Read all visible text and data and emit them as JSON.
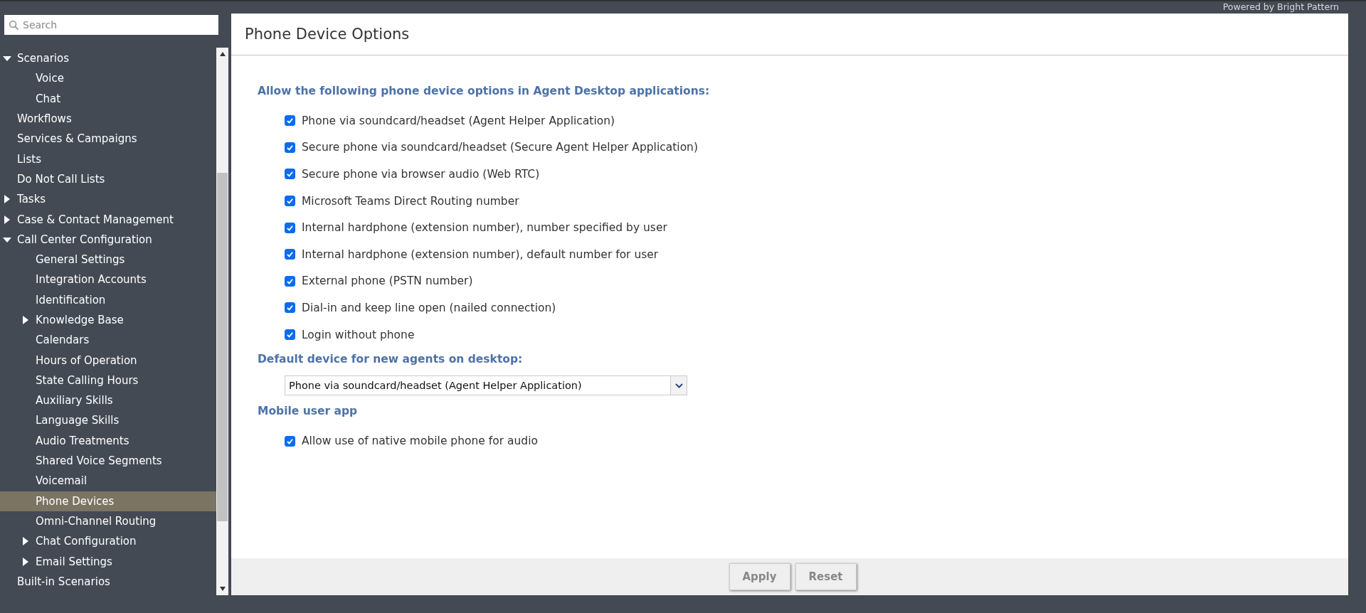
{
  "brand": "Powered by Bright Pattern",
  "sidebar": {
    "search": {
      "placeholder": "Search"
    },
    "items": [
      {
        "label": "Scenarios",
        "expanded": true,
        "selected": false,
        "children": [
          {
            "label": "Voice",
            "selected": false
          },
          {
            "label": "Chat",
            "selected": false
          }
        ]
      },
      {
        "label": "Workflows",
        "selected": false
      },
      {
        "label": "Services & Campaigns",
        "selected": false
      },
      {
        "label": "Lists",
        "selected": false
      },
      {
        "label": "Do Not Call Lists",
        "selected": false
      },
      {
        "label": "Tasks",
        "expanded": false,
        "selected": false
      },
      {
        "label": "Case & Contact Management",
        "expanded": false,
        "selected": false
      },
      {
        "label": "Call Center Configuration",
        "expanded": true,
        "selected": false,
        "children": [
          {
            "label": "General Settings",
            "selected": false
          },
          {
            "label": "Integration Accounts",
            "selected": false
          },
          {
            "label": "Identification",
            "selected": false
          },
          {
            "label": "Knowledge Base",
            "expanded": false,
            "selected": false
          },
          {
            "label": "Calendars",
            "selected": false
          },
          {
            "label": "Hours of Operation",
            "selected": false
          },
          {
            "label": "State Calling Hours",
            "selected": false
          },
          {
            "label": "Auxiliary Skills",
            "selected": false
          },
          {
            "label": "Language Skills",
            "selected": false
          },
          {
            "label": "Audio Treatments",
            "selected": false
          },
          {
            "label": "Shared Voice Segments",
            "selected": false
          },
          {
            "label": "Voicemail",
            "selected": false
          },
          {
            "label": "Phone Devices",
            "selected": true
          },
          {
            "label": "Omni-Channel Routing",
            "selected": false
          },
          {
            "label": "Chat Configuration",
            "expanded": false,
            "selected": false
          },
          {
            "label": "Email Settings",
            "expanded": false,
            "selected": false
          }
        ]
      },
      {
        "label": "Built-in Scenarios",
        "selected": false
      }
    ]
  },
  "page": {
    "title": "Phone Device Options",
    "sections": [
      {
        "kind": "checkboxes",
        "heading": "Allow the following phone device options in Agent Desktop applications:",
        "options": [
          {
            "label": "Phone via soundcard/headset (Agent Helper Application)",
            "checked": true
          },
          {
            "label": "Secure phone via soundcard/headset (Secure Agent Helper Application)",
            "checked": true
          },
          {
            "label": "Secure phone via browser audio (Web RTC)",
            "checked": true
          },
          {
            "label": "Microsoft Teams Direct Routing number",
            "checked": true
          },
          {
            "label": "Internal hardphone (extension number), number specified by user",
            "checked": true
          },
          {
            "label": "Internal hardphone (extension number), default number for user",
            "checked": true
          },
          {
            "label": "External phone (PSTN number)",
            "checked": true
          },
          {
            "label": "Dial-in and keep line open (nailed connection)",
            "checked": true
          },
          {
            "label": "Login without phone",
            "checked": true
          }
        ]
      },
      {
        "kind": "dropdown",
        "heading": "Default device for new agents on desktop:",
        "value": "Phone via soundcard/headset (Agent Helper Application)"
      },
      {
        "kind": "checkboxes",
        "heading": "Mobile user app",
        "options": [
          {
            "label": "Allow use of native mobile phone for audio",
            "checked": true
          }
        ]
      }
    ],
    "buttons": [
      "Apply",
      "Reset"
    ]
  }
}
